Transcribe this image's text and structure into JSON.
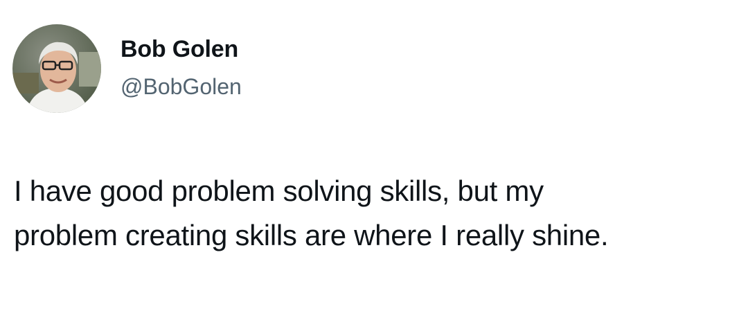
{
  "author": {
    "name": "Bob Golen",
    "handle": "@BobGolen",
    "avatar_icon": "profile-photo"
  },
  "tweet": {
    "lines": [
      "I have good problem solving skills, but my",
      "problem creating skills are where I really shine."
    ]
  },
  "colors": {
    "name": "#0f1419",
    "handle": "#536471",
    "text": "#0f1419",
    "background": "#ffffff"
  }
}
